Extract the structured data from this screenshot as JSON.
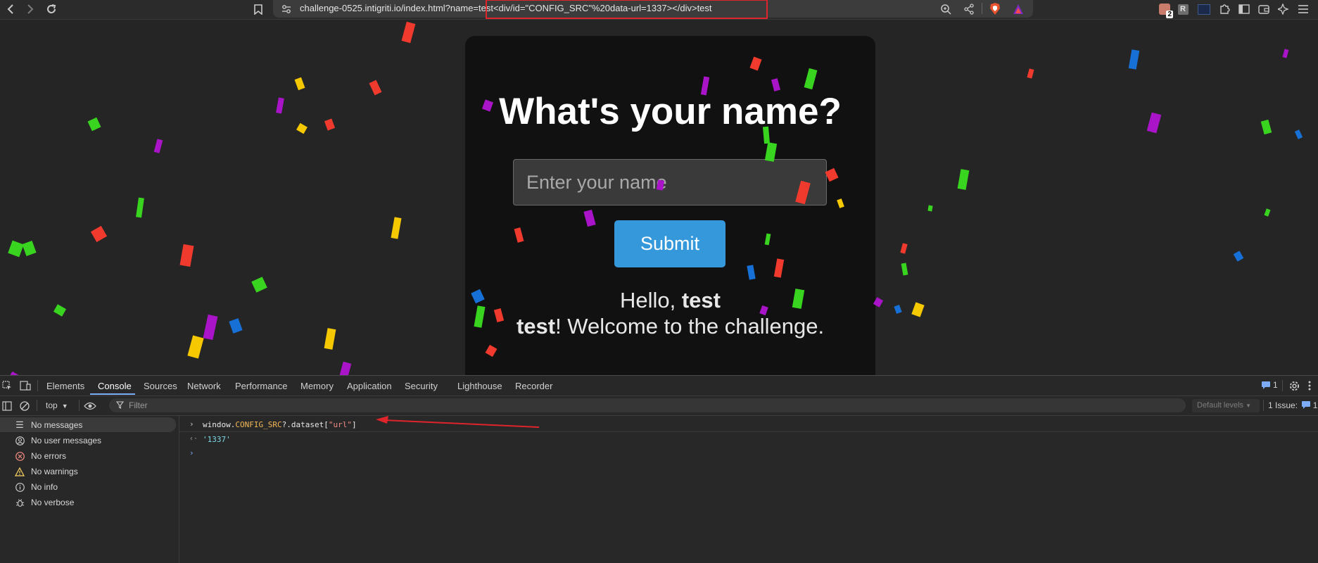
{
  "browser": {
    "url_host": "challenge-0525.intigriti.io",
    "url_rest": "/index.html?name=test<div/id=\"CONFIG_SRC\"%20data-url=1337></div>test",
    "extension_badge": "2",
    "extension_letter": "R"
  },
  "page": {
    "title": "What's your name?",
    "input_placeholder": "Enter your name",
    "submit_label": "Submit",
    "greeting_prefix": "Hello, ",
    "greeting_name1": "test",
    "greeting_name2": "test",
    "greeting_suffix": "! Welcome to the challenge."
  },
  "devtools": {
    "tabs": [
      "Elements",
      "Console",
      "Sources",
      "Network",
      "Performance",
      "Memory",
      "Application",
      "Security",
      "Lighthouse",
      "Recorder"
    ],
    "active_tab": "Console",
    "context": "top",
    "filter_placeholder": "Filter",
    "levels": "Default levels",
    "issues_label": "1 Issue:",
    "issues_count": "1",
    "header_issue_count": "1",
    "sidebar": [
      "No messages",
      "No user messages",
      "No errors",
      "No warnings",
      "No info",
      "No verbose"
    ],
    "console": {
      "input_prefix": "window.",
      "input_var": "CONFIG_SRC",
      "input_mid": "?.dataset[",
      "input_key": "\"url\"",
      "input_end": "]",
      "output": "'1337'"
    }
  },
  "colors": {
    "accent_red": "#e0242b",
    "submit_blue": "#3498db",
    "devtools_active": "#7cacf8"
  }
}
